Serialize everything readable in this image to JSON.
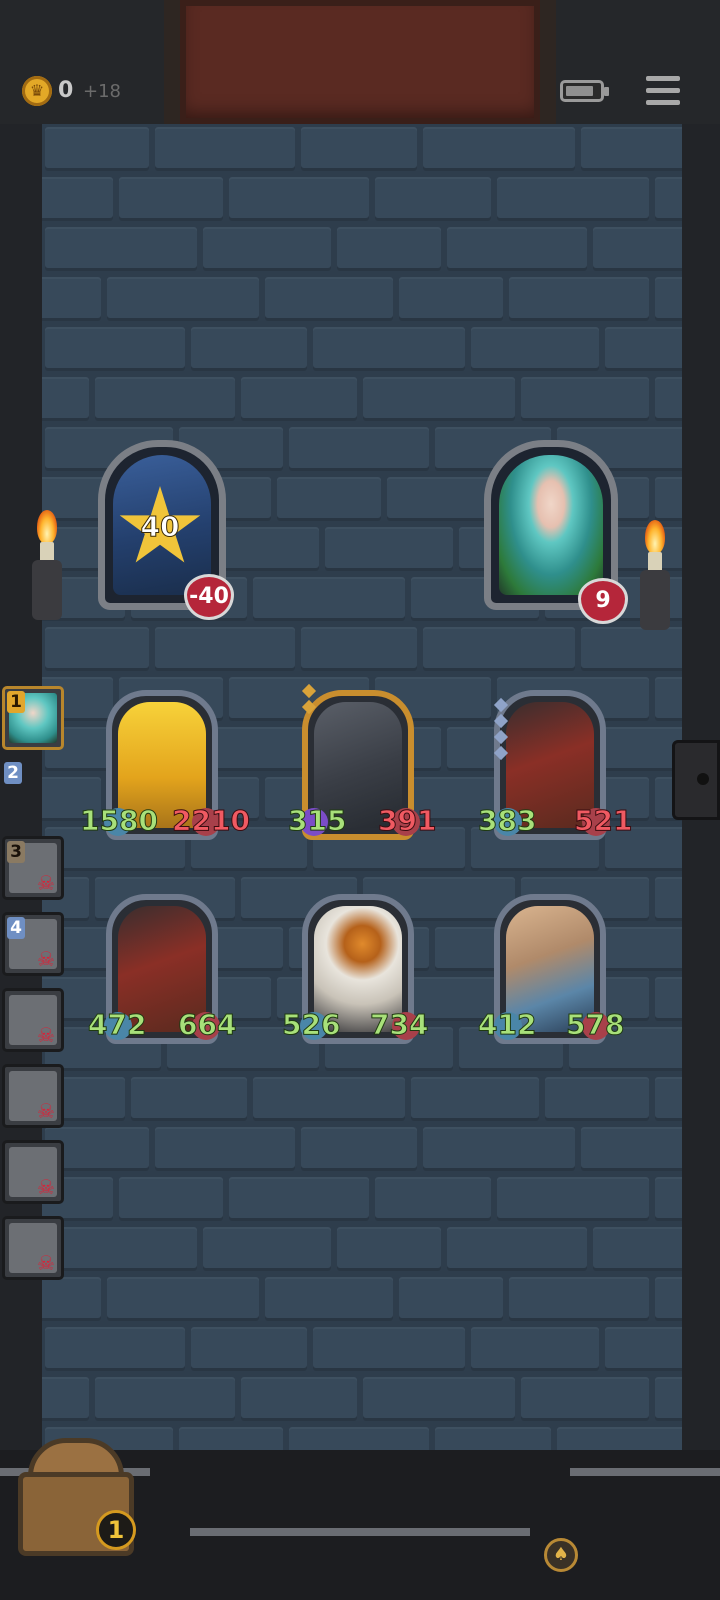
{
  "hud": {
    "gold": "0",
    "gold_increment": "+18",
    "coin_icon": "crown-coin-icon",
    "battery_icon": "battery-icon",
    "battery_level": 0.85,
    "menu_icon": "menu-icon"
  },
  "player": {
    "level": "40",
    "health": "-40",
    "star_icon": "star-icon",
    "heart_icon": "heart-icon"
  },
  "enemy": {
    "health": "9",
    "heart_icon": "heart-icon"
  },
  "queue": {
    "active_number": "1",
    "next_number": "2",
    "defeated_numbers": [
      "3",
      "4"
    ],
    "skull_icon": "skull-icon"
  },
  "units": [
    {
      "attack": "1580",
      "health": "2210",
      "art": "golden-horned-demon"
    },
    {
      "attack": "315",
      "health": "391",
      "art": "grey-dragon"
    },
    {
      "attack": "383",
      "health": "521",
      "art": "red-serpent-dragon"
    },
    {
      "attack": "472",
      "health": "664",
      "art": "red-serpent-dragon"
    },
    {
      "attack": "526",
      "health": "734",
      "art": "pumpkin-head"
    },
    {
      "attack": "412",
      "health": "578",
      "art": "winged-beast"
    }
  ],
  "chest": {
    "count": "1",
    "icon": "treasure-chest-icon"
  },
  "bell_icon": "bell-icon",
  "colors": {
    "attack_text": "#a8e07a",
    "health_text": "#f05a62",
    "wall": "#2e3d4c",
    "gold": "#f0c43a"
  }
}
